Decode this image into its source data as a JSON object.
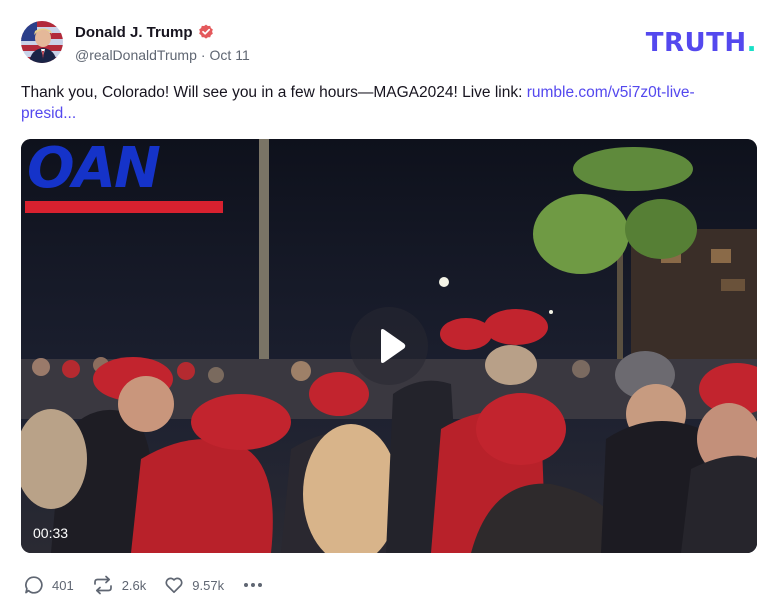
{
  "author": {
    "display_name": "Donald J. Trump",
    "handle": "@realDonaldTrump",
    "separator": "·",
    "date": "Oct 11",
    "verified_color": "#e4595c"
  },
  "brand": {
    "name": "TRUTH",
    "period": ".",
    "color": "#5448ee",
    "period_color": "#18e0c6"
  },
  "status": {
    "text": "Thank you, Colorado! Will see you in a few hours—MAGA2024! Live link: ",
    "link_text": "rumble.com/v5i7z0t-live-presid...",
    "link_color": "#5448ee"
  },
  "video": {
    "duration": "00:33",
    "network_logo": "OAN"
  },
  "actions": {
    "replies": "401",
    "retruths": "2.6k",
    "likes": "9.57k"
  }
}
